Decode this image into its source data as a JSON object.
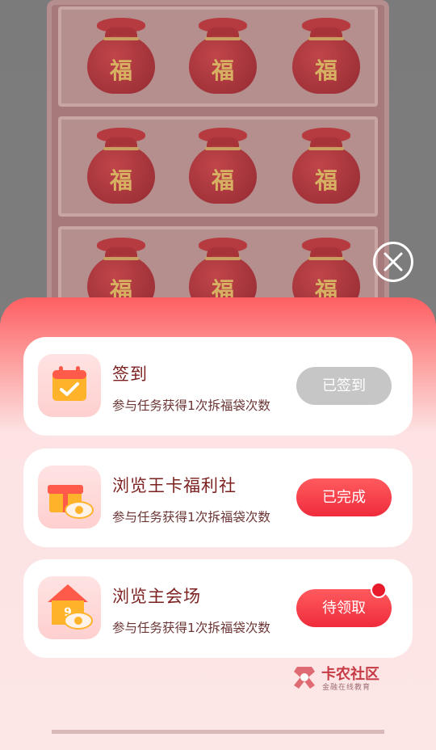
{
  "background": {
    "bag_character": "福",
    "bag_count": 9
  },
  "close_button": {
    "icon": "close-icon"
  },
  "tasks": [
    {
      "title": "签到",
      "desc": "参与任务获得1次拆福袋次数",
      "action": "已签到",
      "state": "disabled",
      "icon": "calendar-check-icon"
    },
    {
      "title": "浏览王卡福利社",
      "desc": "参与任务获得1次拆福袋次数",
      "action": "已完成",
      "state": "active",
      "icon": "gift-eye-icon"
    },
    {
      "title": "浏览主会场",
      "desc": "参与任务获得1次拆福袋次数",
      "action": "待领取",
      "state": "active",
      "icon": "house-nine-eye-icon",
      "badge_dot": true
    }
  ],
  "watermark": {
    "title": "卡农社区",
    "subtitle": "金融在线教育"
  },
  "colors": {
    "accent": "#ef2c3c",
    "disabled": "#c6c6c6",
    "title_text": "#7b1f1f"
  }
}
